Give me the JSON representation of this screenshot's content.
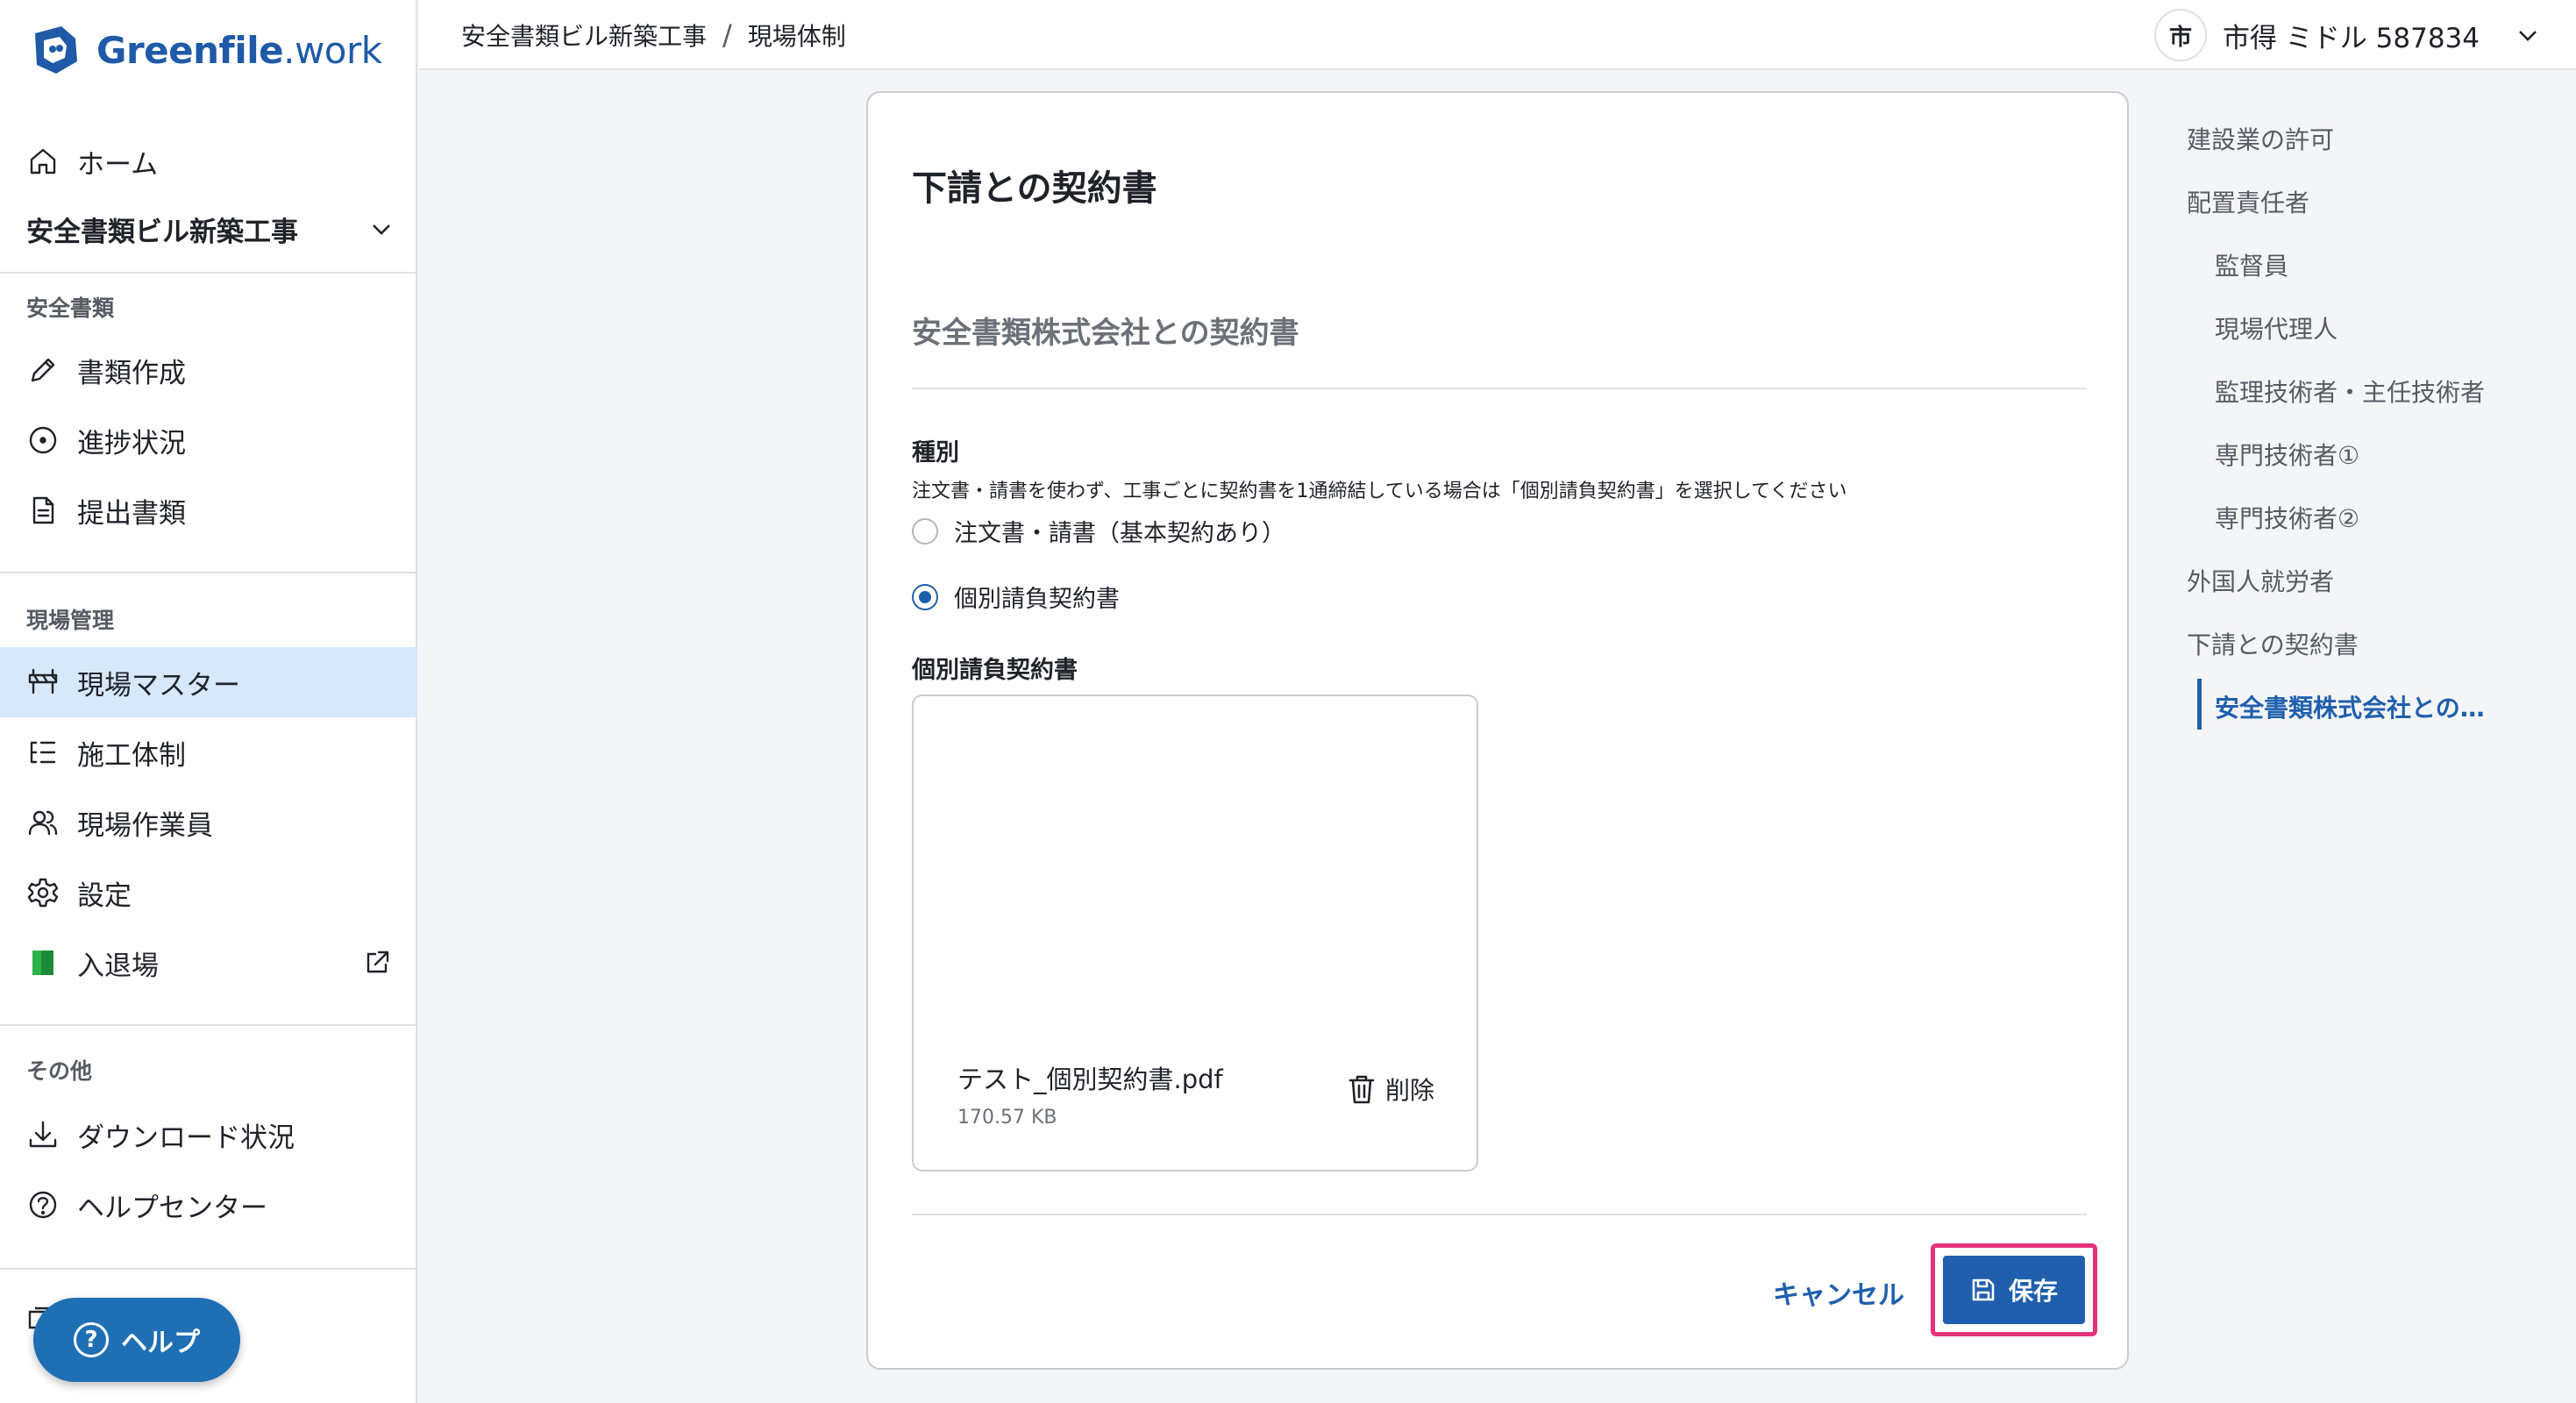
{
  "brand": {
    "name_main": "Greenfile",
    "name_suffix": ".work",
    "accent": "#1f5fad",
    "highlight": "#e5337a",
    "active_bg": "#d6e8fa"
  },
  "sidebar": {
    "home": "ホーム",
    "project": "安全書類ビル新築工事",
    "section_safety": "安全書類",
    "safety_items": [
      "書類作成",
      "進捗状況",
      "提出書類"
    ],
    "section_site": "現場管理",
    "site_items": [
      "現場マスター",
      "施工体制",
      "現場作業員",
      "設定",
      "入退場"
    ],
    "section_other": "その他",
    "other_items": [
      "ダウンロード状況",
      "ヘルプセンター"
    ],
    "help_button": "ヘルプ"
  },
  "header": {
    "breadcrumb": [
      "安全書類ビル新築工事",
      "現場体制"
    ],
    "breadcrumb_sep": "/",
    "user_avatar": "市",
    "user_name": "市得 ミドル 587834"
  },
  "main": {
    "title": "下請との契約書",
    "subtitle": "安全書類株式会社との契約書",
    "type_label": "種別",
    "type_help": "注文書・請書を使わず、工事ごとに契約書を1通締結している場合は「個別請負契約書」を選択してください",
    "options": [
      {
        "label": "注文書・請書（基本契約あり）",
        "checked": false
      },
      {
        "label": "個別請負契約書",
        "checked": true
      }
    ],
    "file_label": "個別請負契約書",
    "file": {
      "name": "テスト_個別契約書.pdf",
      "size": "170.57 KB",
      "delete_label": "削除"
    },
    "cancel": "キャンセル",
    "save": "保存"
  },
  "toc": {
    "items": [
      {
        "label": "建設業の許可",
        "level": 1
      },
      {
        "label": "配置責任者",
        "level": 1
      },
      {
        "label": "監督員",
        "level": 2
      },
      {
        "label": "現場代理人",
        "level": 2
      },
      {
        "label": "監理技術者・主任技術者",
        "level": 2
      },
      {
        "label": "専門技術者①",
        "level": 2
      },
      {
        "label": "専門技術者②",
        "level": 2
      },
      {
        "label": "外国人就労者",
        "level": 1
      },
      {
        "label": "下請との契約書",
        "level": 1
      }
    ],
    "active": "安全書類株式会社との…"
  }
}
